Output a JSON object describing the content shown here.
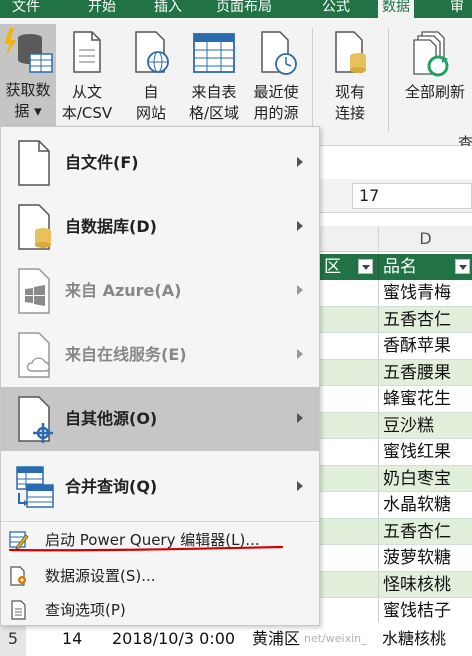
{
  "ribbon_tabs": [
    {
      "label": "文件"
    },
    {
      "label": "开始"
    },
    {
      "label": "插入"
    },
    {
      "label": "页面布局"
    },
    {
      "label": "公式"
    },
    {
      "label": "数据"
    },
    {
      "label": "审"
    }
  ],
  "ribbon_buttons": [
    {
      "line1": "获取数",
      "line2": "据 ▾",
      "icon": "database-lightning-icon"
    },
    {
      "line1": "从文",
      "line2": "本/CSV",
      "icon": "text-file-icon"
    },
    {
      "line1": "自",
      "line2": "网站",
      "icon": "web-page-icon"
    },
    {
      "line1": "来自表",
      "line2": "格/区域",
      "icon": "table-icon"
    },
    {
      "line1": "最近使",
      "line2": "用的源",
      "icon": "recent-source-icon"
    },
    {
      "line1": "现有",
      "line2": "连接",
      "icon": "existing-connection-icon"
    },
    {
      "line1": "全部刷新",
      "line2": "",
      "icon": "refresh-all-icon"
    }
  ],
  "ribbon_partial_label": "查",
  "formula_bar_value": "17",
  "column_header": "D",
  "table_headers": {
    "district": "区",
    "product": "品名"
  },
  "product_cells": [
    "蜜饯青梅",
    "五香杏仁",
    "香酥苹果",
    "五香腰果",
    "蜂蜜花生",
    "豆沙糕",
    "蜜饯红果",
    "奶白枣宝",
    "水晶软糖",
    "五香杏仁",
    "菠萝软糖",
    "怪味核桃",
    "蜜饯桔子"
  ],
  "bottom_row": {
    "row_number": "5",
    "index": "14",
    "date": "2018/10/3 0:00",
    "district": "黄浦区",
    "product": "水糖核桃",
    "watermark": "net/weixin_"
  },
  "menu": {
    "items": [
      {
        "label": "自文件(F)",
        "icon": "file-icon",
        "enabled": true
      },
      {
        "label": "自数据库(D)",
        "icon": "database-file-icon",
        "enabled": true
      },
      {
        "label": "来自 Azure(A)",
        "icon": "windows-azure-icon",
        "enabled": false
      },
      {
        "label": "来自在线服务(E)",
        "icon": "cloud-file-icon",
        "enabled": false
      },
      {
        "label": "自其他源(O)",
        "icon": "other-source-icon",
        "enabled": true
      },
      {
        "label": "合并查询(Q)",
        "icon": "combine-query-icon",
        "enabled": true
      }
    ],
    "commands": [
      {
        "label": "启动 Power Query 编辑器(L)...",
        "icon": "power-query-editor-icon"
      },
      {
        "label": "数据源设置(S)...",
        "icon": "data-source-settings-icon"
      },
      {
        "label": "查询选项(P)",
        "icon": "query-options-icon"
      }
    ]
  },
  "colors": {
    "excel_green": "#217346",
    "band_green": "#e2efda",
    "highlight": "#c6c6c6",
    "annotation_red": "#d40000"
  }
}
